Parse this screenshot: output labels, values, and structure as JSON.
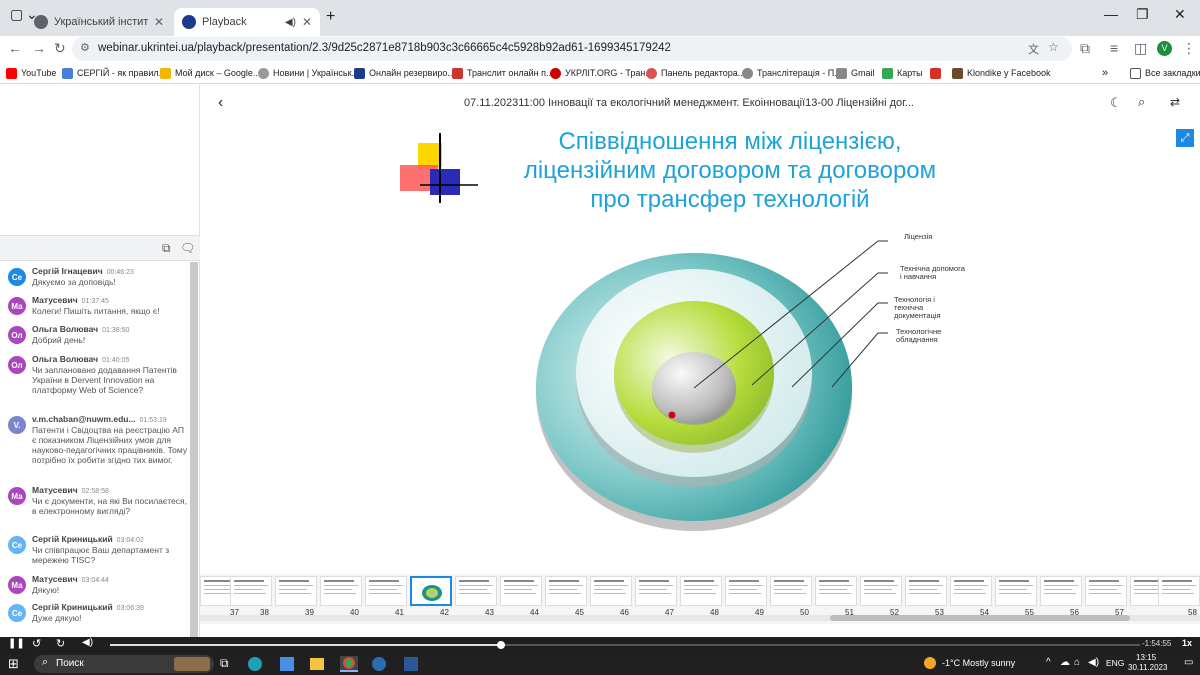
{
  "browser": {
    "tabs": [
      {
        "label": "Український інститут науково",
        "active": false
      },
      {
        "label": "Playback",
        "active": true
      }
    ],
    "url": "webinar.ukrintei.ua/playback/presentation/2.3/9d25c2871e8718b903c3c66665c4c5928b92ad61-1699345179242",
    "profile_initial": "V",
    "bookmarks": [
      {
        "label": "YouTube",
        "color": "#ff0000"
      },
      {
        "label": "СЕРГІЙ - як правил...",
        "color": "#4a7fd6"
      },
      {
        "label": "Мой диск – Google...",
        "color": "#f4b400"
      },
      {
        "label": "Новини | Українськ...",
        "color": "#999999"
      },
      {
        "label": "Онлайн резервиро...",
        "color": "#1a3c8c"
      },
      {
        "label": "Транслит онлайн п...",
        "color": "#cc3333"
      },
      {
        "label": "УКРЛІТ.ORG - Тран...",
        "color": "#cc0000"
      },
      {
        "label": "Панель редактора...",
        "color": "#d9534f"
      },
      {
        "label": "Транслітерація - П...",
        "color": "#888888"
      },
      {
        "label": "Gmail",
        "color": "#888888"
      },
      {
        "label": "Карты",
        "color": "#34a853"
      },
      {
        "label": "",
        "color": "#d93025"
      },
      {
        "label": "Klondike у Facebook",
        "color": "#6b4a2b"
      }
    ],
    "all_bookmarks_label": "Все закладки"
  },
  "chat": {
    "messages": [
      {
        "initials": "Се",
        "color": "#1e88e5",
        "name": "Сергій Ігнацевич",
        "time": "00:46:23",
        "text": "Дякуємо за доповідь!"
      },
      {
        "initials": "Ма",
        "color": "#ab47bc",
        "name": "Матусевич",
        "time": "01:37:45",
        "text": "Колеги! Пишіть питання, якщо є!"
      },
      {
        "initials": "Ол",
        "color": "#ab47bc",
        "name": "Ольга Волювач",
        "time": "01:38:50",
        "text": "Добрий день!"
      },
      {
        "initials": "Ол",
        "color": "#ab47bc",
        "name": "Ольга Волювач",
        "time": "01:40:05",
        "text": "Чи заплановано додавання Патентів України в Dervent Innovation на платформу Web of Science?"
      },
      {
        "initials": "V.",
        "color": "#7986cb",
        "name": "v.m.chaban@nuwm.edu...",
        "time": "01:53:19",
        "text": "Патенти і Свідоцтва на реєстрацію АП є показником Ліцензійних умов для науково-педагогічних працівників. Тому потрібно їх робити згідно тих вимог."
      },
      {
        "initials": "Ма",
        "color": "#ab47bc",
        "name": "Матусевич",
        "time": "02:58:58",
        "text": "Чи є документи, на які Ви посилаєтеся, в електронному вигляді?"
      },
      {
        "initials": "Се",
        "color": "#64b5f6",
        "name": "Сергій Криницький",
        "time": "03:04:02",
        "text": "Чи співпрацює Ваш департамент з мережею TISC?"
      },
      {
        "initials": "Ма",
        "color": "#ab47bc",
        "name": "Матусевич",
        "time": "03:04:44",
        "text": "Дякую!"
      },
      {
        "initials": "Се",
        "color": "#64b5f6",
        "name": "Сергій Криницький",
        "time": "03:06:39",
        "text": "Дуже дякую!"
      }
    ]
  },
  "presentation": {
    "header_title": "07.11.202311:00 Інновації та екологічний менеджмент. Екоінновації13-00 Ліцензійні дог...",
    "slide_title_lines": [
      "Співвідношення між ліцензією,",
      "ліцензійним договором та договором",
      "про трансфер технологій"
    ],
    "diagram_labels": [
      "Ліцензія",
      "Технічна допомога і навчання",
      "Технологія і технічна документація",
      "Технологічне обладнання"
    ],
    "thumbnail_numbers": [
      "37",
      "38",
      "39",
      "40",
      "41",
      "42",
      "43",
      "44",
      "45",
      "46",
      "47",
      "48",
      "49",
      "50",
      "51",
      "52",
      "53",
      "54",
      "55",
      "56",
      "57",
      "58"
    ],
    "current_slide": "41"
  },
  "player": {
    "progress_fraction": 0.38,
    "time": "-1:54:55",
    "speed": "1x"
  },
  "taskbar": {
    "search_label": "Поиск",
    "weather": "-1°C  Mostly sunny",
    "language": "ENG",
    "time": "13:15",
    "date": "30.11.2023"
  }
}
